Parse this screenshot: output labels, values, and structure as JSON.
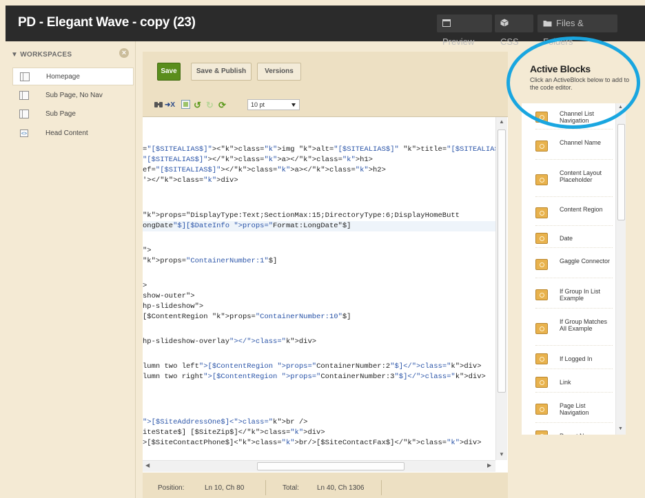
{
  "header": {
    "title": "PD - Elegant Wave - copy (23)",
    "buttons": [
      {
        "label": "Preview",
        "icon": "window-icon"
      },
      {
        "label": "CSS",
        "icon": "cube-icon"
      },
      {
        "label": "Files & Folders",
        "icon": "folder-icon"
      }
    ]
  },
  "sidebar": {
    "heading": "▼ WORKSPACES",
    "items": [
      {
        "label": "Homepage"
      },
      {
        "label": "Sub Page, No Nav"
      },
      {
        "label": "Sub Page"
      },
      {
        "label": "Head Content"
      }
    ]
  },
  "toolbar": {
    "save_label": "Save",
    "save_publish_label": "Save & Publish",
    "versions_label": "Versions",
    "font_size": "10 pt"
  },
  "editor": {
    "lines": [
      "=\"[$SITEALIAS$]\"><img alt=\"[$SITEALIAS$]\" title=\"[$SITEALIAS$]\" /></",
      "\"[$SITEALIAS$]\"></a></h1>",
      "ef=\"[$SITEALIAS$]\"></a></h2>",
      "'></div>",
      "",
      "",
      "props=\"DisplayType:Text;SectionMax:15;DirectoryType:6;DisplayHomeButt",
      "ongDate\"$][$DateInfo props=\"Format:LongDate\"$]",
      "",
      "\">",
      "props=\"ContainerNumber:1\"$]",
      "",
      ">",
      "show-outer\">",
      "hp-slideshow\">",
      "[$ContentRegion props=\"ContainerNumber:10\"$]",
      "",
      "hp-slideshow-overlay\"></div>",
      "",
      "lumn two left\">[$ContentRegion props=\"ContainerNumber:2\"$]</div>",
      "lumn two right\">[$ContentRegion props=\"ContainerNumber:3\"$]</div>",
      "",
      "",
      "",
      "\">[$SiteAddressOne$]<br />",
      "iteState$] [$SiteZip$]</div>",
      ">[$SiteContactPhone$]<br/>[$SiteContactFax$]</div>"
    ]
  },
  "status": {
    "position_label": "Position:",
    "position_value": "Ln 10, Ch 80",
    "total_label": "Total:",
    "total_value": "Ln 40, Ch 1306"
  },
  "active_blocks": {
    "title": "Active Blocks",
    "description": "Click an ActiveBlock below to add to the code editor.",
    "items": [
      {
        "label": "Channel List Navigation"
      },
      {
        "label": "Channel Name"
      },
      {
        "label": "Content Layout Placeholder"
      },
      {
        "label": "Content Region"
      },
      {
        "label": "Date"
      },
      {
        "label": "Gaggle Connector"
      },
      {
        "label": "If Group In List Example"
      },
      {
        "label": "If Group Matches All Example"
      },
      {
        "label": "If Logged In"
      },
      {
        "label": "Link"
      },
      {
        "label": "Page List Navigation"
      },
      {
        "label": "Parent Name"
      }
    ]
  },
  "colors": {
    "header_bg": "#2b2b2b",
    "panel_bg": "#f4ead4",
    "save_green": "#5a8d1c",
    "annotation_blue": "#19a6e0",
    "block_icon": "#e8b24d"
  }
}
